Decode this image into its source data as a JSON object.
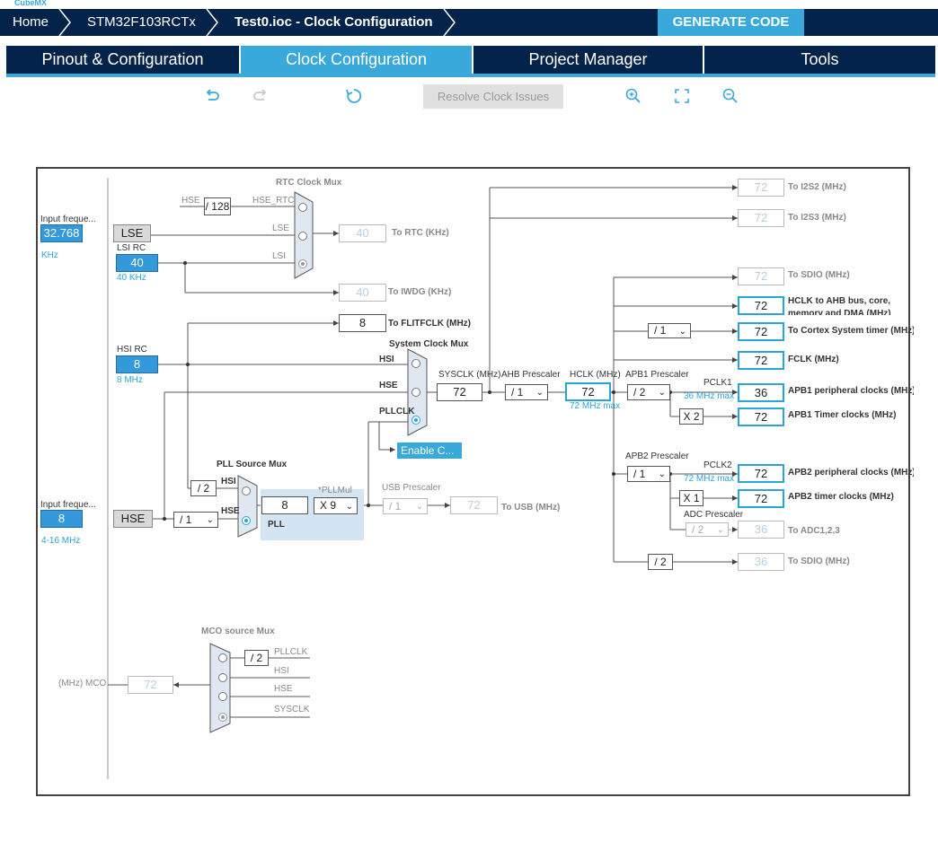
{
  "app_strip": "CubeMX",
  "breadcrumb": {
    "home": "Home",
    "device": "STM32F103RCTx",
    "file": "Test0.ioc - Clock Configuration"
  },
  "generate_label": "GENERATE CODE",
  "tabs": [
    {
      "label": "Pinout & Configuration"
    },
    {
      "label": "Clock Configuration"
    },
    {
      "label": "Project Manager"
    },
    {
      "label": "Tools"
    }
  ],
  "toolbar": {
    "undo": "undo-icon",
    "redo": "redo-icon",
    "reset": "refresh-icon",
    "resolve_label": "Resolve Clock Issues",
    "zoom_in": "zoom-in-icon",
    "fit": "fit-screen-icon",
    "zoom_out": "zoom-out-icon"
  },
  "colors": {
    "navy": "#03234b",
    "accent": "#39a9dc",
    "box_fill": "#3399db"
  },
  "clock": {
    "lse": {
      "input_label": "Input freque...",
      "value": "32.768",
      "unit": "KHz",
      "label": "LSE"
    },
    "lsi": {
      "title": "LSI RC",
      "value": "40",
      "note": "40 KHz"
    },
    "hsi": {
      "title": "HSI RC",
      "value": "8",
      "note": "8 MHz"
    },
    "hse": {
      "input_label": "Input freque...",
      "value": "8",
      "range": "4-16 MHz",
      "label": "HSE"
    },
    "rtc": {
      "title": "RTC Clock Mux",
      "hse_label": "HSE",
      "div128": "/ 128",
      "in_hse_rtc": "HSE_RTC",
      "in_lse": "LSE",
      "in_lsi": "LSI",
      "out_value": "40",
      "out_label": "To RTC (KHz)"
    },
    "iwdg": {
      "value": "40",
      "label": "To IWDG (KHz)"
    },
    "flit": {
      "value": "8",
      "label": "To FLITFCLK (MHz)"
    },
    "pll": {
      "src_title": "PLL Source Mux",
      "hsi_div": "/ 2",
      "in_hsi": "HSI",
      "in_hse": "HSE",
      "hse_prediv": "/ 1",
      "value": "8",
      "mul_title": "*PLLMul",
      "mul": "X 9",
      "name": "PLL"
    },
    "usb": {
      "title": "USB Prescaler",
      "div": "/ 1",
      "value": "72",
      "label": "To USB (MHz)"
    },
    "sys": {
      "title": "System Clock Mux",
      "in_hsi": "HSI",
      "in_hse": "HSE",
      "in_pll": "PLLCLK",
      "enable_css": "Enable C...",
      "sysclk_label": "SYSCLK (MHz)",
      "sysclk": "72"
    },
    "ahb": {
      "title": "AHB Prescaler",
      "div": "/ 1"
    },
    "hclk": {
      "title": "HCLK (MHz)",
      "value": "72",
      "max": "72 MHz max"
    },
    "apb1": {
      "title": "APB1 Prescaler",
      "div": "/ 2",
      "pclk": "PCLK1",
      "max": "36 MHz max",
      "periph": "36",
      "periph_label": "APB1 peripheral clocks (MHz)",
      "timer_mul": "X 2",
      "timer": "72",
      "timer_label": "APB1 Timer clocks (MHz)"
    },
    "apb2": {
      "title": "APB2 Prescaler",
      "div": "/ 1",
      "pclk": "PCLK2",
      "max": "72 MHz max",
      "periph": "72",
      "periph_label": "APB2 peripheral clocks (MHz)",
      "timer_mul": "X 1",
      "timer": "72",
      "timer_label": "APB2 timer clocks (MHz)"
    },
    "adc": {
      "title": "ADC Prescaler",
      "div": "/ 2",
      "value": "36",
      "label": "To ADC1,2,3"
    },
    "sdio2": {
      "div": "/ 2",
      "value": "36",
      "label": "To SDIO (MHz)"
    },
    "outputs": {
      "i2s2": {
        "value": "72",
        "label": "To I2S2 (MHz)"
      },
      "i2s3": {
        "value": "72",
        "label": "To I2S3 (MHz)"
      },
      "sdio": {
        "value": "72",
        "label": "To SDIO (MHz)"
      },
      "hclk_ahb": {
        "value": "72",
        "label1": "HCLK to AHB bus, core,",
        "label2": "memory and DMA (MHz)"
      },
      "cortex": {
        "div": "/ 1",
        "value": "72",
        "label": "To Cortex System timer (MHz)"
      },
      "fclk": {
        "value": "72",
        "label": "FCLK (MHz)"
      }
    },
    "mco": {
      "title": "MCO source Mux",
      "label": "(MHz) MCO",
      "value": "72",
      "div": "/ 2",
      "in_pll": "PLLCLK",
      "in_hsi": "HSI",
      "in_hse": "HSE",
      "in_sys": "SYSCLK"
    }
  }
}
